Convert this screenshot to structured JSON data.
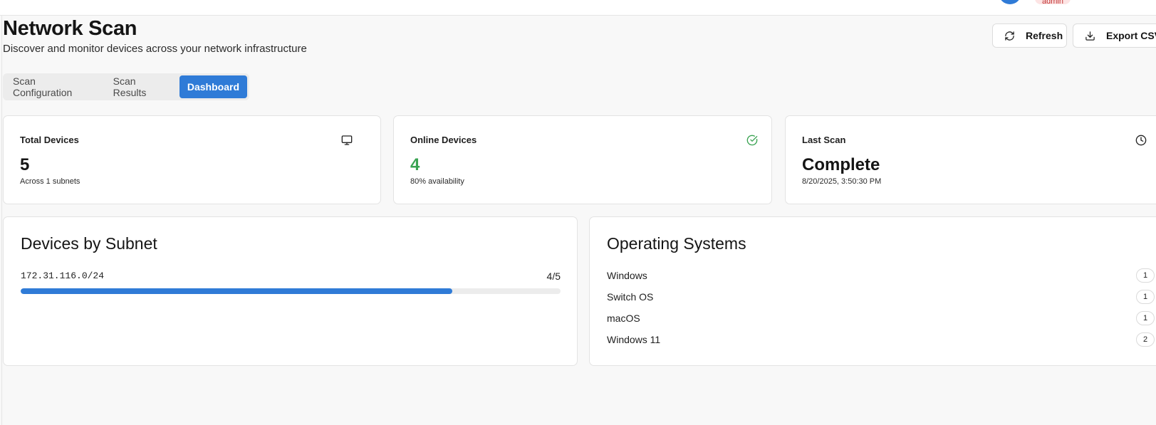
{
  "header": {
    "role_badge": "admin"
  },
  "page": {
    "title": "Network Scan",
    "subtitle": "Discover and monitor devices across your network infrastructure"
  },
  "actions": {
    "refresh_label": "Refresh",
    "export_label": "Export CSV"
  },
  "tabs": [
    {
      "label": "Scan Configuration",
      "active": false
    },
    {
      "label": "Scan Results",
      "active": false
    },
    {
      "label": "Dashboard",
      "active": true
    }
  ],
  "stats": {
    "total": {
      "label": "Total Devices",
      "value": "5",
      "sub": "Across 1 subnets",
      "icon": "monitor-icon"
    },
    "online": {
      "label": "Online Devices",
      "value": "4",
      "sub": "80% availability",
      "icon": "check-circle-icon",
      "color": "#3aa352"
    },
    "last_scan": {
      "label": "Last Scan",
      "value": "Complete",
      "sub": "8/20/2025, 3:50:30 PM",
      "icon": "clock-icon"
    }
  },
  "subnets": {
    "title": "Devices by Subnet",
    "items": [
      {
        "cidr": "172.31.116.0/24",
        "count": "4/5",
        "online": 4,
        "total": 5
      }
    ]
  },
  "os": {
    "title": "Operating Systems",
    "items": [
      {
        "name": "Windows",
        "count": "1"
      },
      {
        "name": "Switch OS",
        "count": "1"
      },
      {
        "name": "macOS",
        "count": "1"
      },
      {
        "name": "Windows 11",
        "count": "2"
      }
    ]
  },
  "colors": {
    "accent": "#2f7bd7",
    "success": "#3aa352",
    "badge_bg": "#fde4e4"
  }
}
